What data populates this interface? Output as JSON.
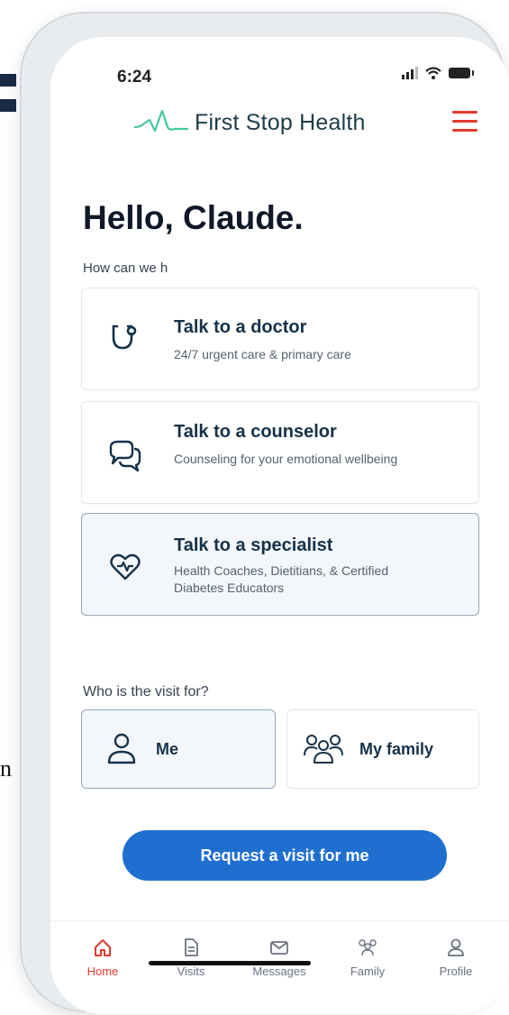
{
  "status_bar": {
    "time": "6:24"
  },
  "header": {
    "brand": "First Stop Health",
    "menu_icon": "hamburger-menu-icon",
    "accent_color": "#e03b2e"
  },
  "main": {
    "greeting": "Hello, Claude.",
    "subtitle": "How can we h",
    "services": [
      {
        "icon": "stethoscope-icon",
        "title": "Talk to a doctor",
        "description": "24/7 urgent care & primary care"
      },
      {
        "icon": "chat-bubbles-icon",
        "title": "Talk to a counselor",
        "description": "Counseling for your emotional wellbeing"
      },
      {
        "icon": "heart-hands-icon",
        "title": "Talk to a specialist",
        "description": "Health Coaches, Dietitians, & Certified Diabetes Educators",
        "selected": true
      }
    ],
    "visit_question": "Who is the visit for?",
    "visit_options": [
      {
        "icon": "person-icon",
        "label": "Me",
        "selected": true
      },
      {
        "icon": "family-icon",
        "label": "My family",
        "selected": false
      }
    ],
    "cta_label": "Request a visit for me",
    "cta_color": "#1f6fd1"
  },
  "tab_bar": {
    "tabs": [
      {
        "icon": "home-icon",
        "label": "Home",
        "active": true
      },
      {
        "icon": "document-icon",
        "label": "Visits"
      },
      {
        "icon": "envelope-icon",
        "label": "Messages"
      },
      {
        "icon": "family-icon",
        "label": "Family"
      },
      {
        "icon": "person-icon",
        "label": "Profile"
      }
    ]
  }
}
